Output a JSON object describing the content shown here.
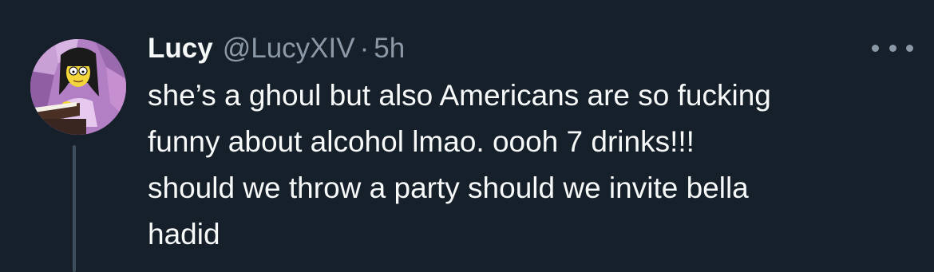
{
  "tweet": {
    "display_name": "Lucy",
    "handle": "@LucyXIV",
    "separator": "·",
    "time": "5h",
    "text": "she’s a ghoul but also Americans are so fucking\nfunny about alcohol lmao. oooh 7 drinks!!!\nshould we throw a party should we invite bella\nhadid",
    "avatar": "cartoon-character-avatar",
    "more_icon": "more-options-icon"
  },
  "colors": {
    "background": "#15202b",
    "text_primary": "#f7f9f9",
    "text_secondary": "#8b98a5",
    "thread_line": "#3d4f5c"
  }
}
